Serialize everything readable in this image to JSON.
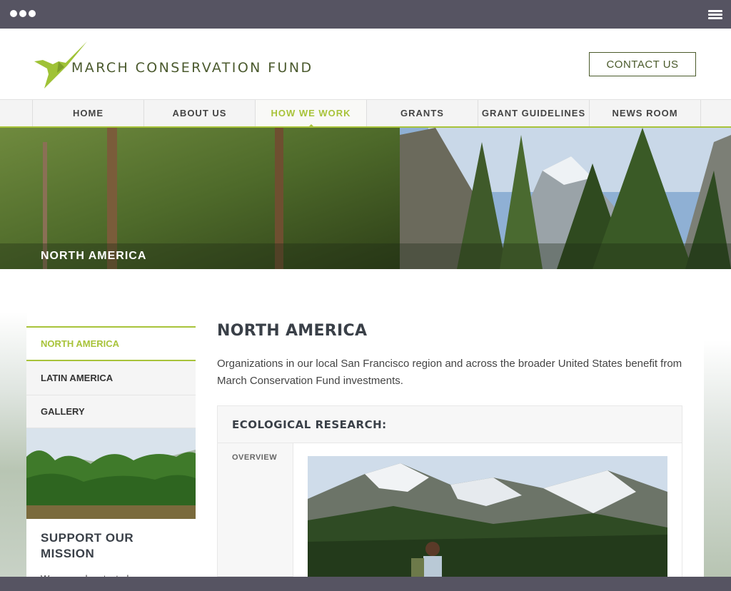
{
  "brand": {
    "name": "MARCH CONSERVATION FUND",
    "accent": "#a8c33a",
    "text_dark": "#3a4048"
  },
  "header": {
    "contact_label": "CONTACT US"
  },
  "nav": {
    "items": [
      {
        "label": "HOME"
      },
      {
        "label": "ABOUT US"
      },
      {
        "label": "HOW WE WORK"
      },
      {
        "label": "GRANTS"
      },
      {
        "label": "GRANT GUIDELINES"
      },
      {
        "label": "NEWS ROOM"
      }
    ],
    "active_index": 2
  },
  "hero": {
    "title": "NORTH AMERICA"
  },
  "sidebar": {
    "items": [
      {
        "label": "NORTH AMERICA"
      },
      {
        "label": "LATIN AMERICA"
      },
      {
        "label": "GALLERY"
      }
    ],
    "active_index": 0,
    "support_title": "SUPPORT OUR MISSION",
    "support_text": "We expand protected areas, support ecological research, and"
  },
  "main": {
    "title": "NORTH AMERICA",
    "intro": "Organizations in our local San Francisco region and across the broader United States benefit from March Conservation Fund investments.",
    "panel_heading": "ECOLOGICAL RESEARCH:",
    "panel_tab": "OVERVIEW"
  },
  "icons": {
    "logo": "hummingbird-icon",
    "menu": "hamburger-menu-icon"
  }
}
